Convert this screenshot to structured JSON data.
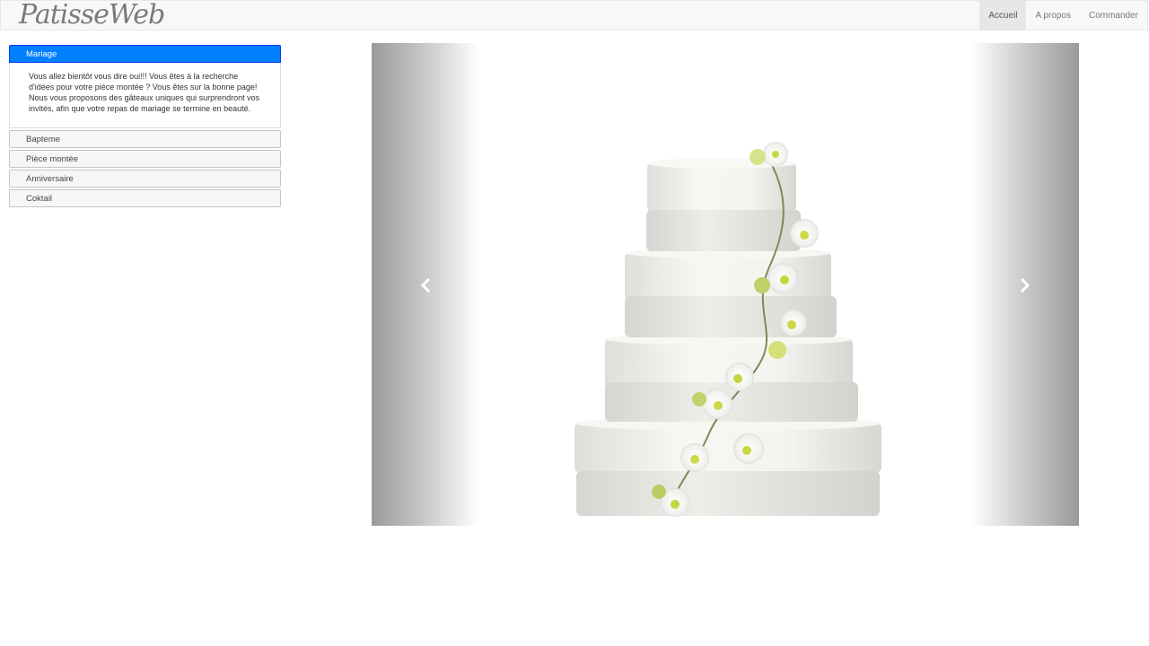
{
  "navbar": {
    "brand": "PatisseWeb",
    "items": [
      {
        "label": "Accueil",
        "active": true
      },
      {
        "label": "A propos",
        "active": false
      },
      {
        "label": "Commander",
        "active": false
      }
    ]
  },
  "sidebar": {
    "sections": [
      {
        "title": "Mariage",
        "text": "Vous allez bientôt vous dire oui!!! Vous êtes à la recherche d'idées pour votre pièce montée ? Vous êtes sur la bonne page! Nous vous proposons des gâteaux uniques qui surprendront vos invités, afin que votre repas de mariage se termine en beauté."
      },
      {
        "title": "Bapteme"
      },
      {
        "title": "Pièce montée"
      },
      {
        "title": "Anniversaire"
      },
      {
        "title": "Coktail"
      }
    ]
  },
  "carousel": {
    "image": "wedding-cake-with-orchids",
    "prev_icon": "chevron-left-icon",
    "next_icon": "chevron-right-icon"
  },
  "colors": {
    "accent": "#007fff",
    "navbar_bg": "#f8f8f8"
  }
}
